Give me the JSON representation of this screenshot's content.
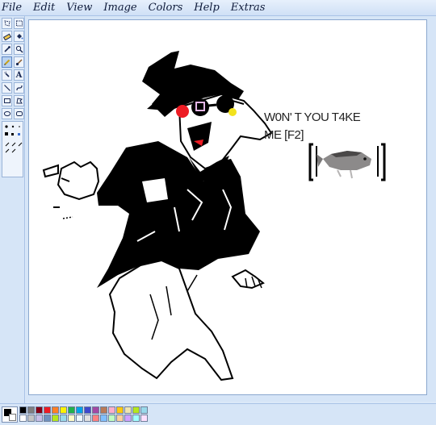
{
  "menu": {
    "items": [
      "File",
      "Edit",
      "View",
      "Image",
      "Colors",
      "Help",
      "Extras"
    ]
  },
  "toolbox": {
    "tools": [
      "free-select-icon",
      "rect-select-icon",
      "eraser-icon",
      "fill-bucket-icon",
      "color-picker-icon",
      "magnifier-icon",
      "pencil-icon",
      "brush-icon",
      "airbrush-icon",
      "text-icon",
      "line-icon",
      "curve-icon",
      "rectangle-icon",
      "polygon-icon",
      "ellipse-icon",
      "rounded-rect-icon"
    ],
    "selected": "pencil-icon"
  },
  "canvas": {
    "caption_line1": "W0N' T YOU T4KE",
    "caption_line2": "ME [F2]"
  },
  "palette": {
    "foreground": "#000000",
    "background": "#ffffff",
    "colors": [
      "#000000",
      "#7f7f7f",
      "#880015",
      "#ed1c24",
      "#ff7f27",
      "#fff200",
      "#22b14c",
      "#00a2e8",
      "#3f48cc",
      "#a349a4",
      "#b97a57",
      "#ffaec9",
      "#ffc90e",
      "#efe4b0",
      "#b5e61d",
      "#99d9ea",
      "#ffffff",
      "#c3c3c3",
      "#c8bfe7",
      "#7092be",
      "#b5e61d",
      "#99d9ea",
      "#fffbc8",
      "#f0f8ff",
      "#e0e0e0",
      "#ff8080",
      "#80c0ff",
      "#c0ffc0",
      "#ffd0a0",
      "#d0a0ff",
      "#a0ffff",
      "#ffe0ff"
    ]
  }
}
